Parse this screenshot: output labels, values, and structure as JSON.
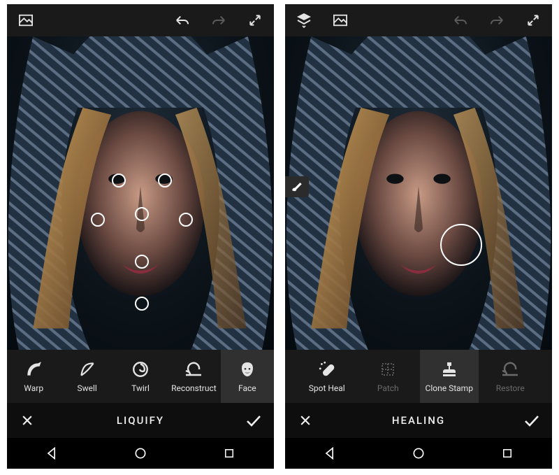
{
  "left": {
    "top": {
      "image_icon": "image-swap-icon",
      "undo": "undo",
      "redo": "redo",
      "fullscreen": "fullscreen"
    },
    "tools": [
      {
        "name": "warp",
        "label": "Warp",
        "selected": false,
        "dim": false
      },
      {
        "name": "swell",
        "label": "Swell",
        "selected": false,
        "dim": false
      },
      {
        "name": "twirl",
        "label": "Twirl",
        "selected": false,
        "dim": false
      },
      {
        "name": "reconstruct",
        "label": "Reconstruct",
        "selected": false,
        "dim": false
      },
      {
        "name": "face",
        "label": "Face",
        "selected": true,
        "dim": false
      }
    ],
    "titlebar": {
      "title": "LIQUIFY"
    }
  },
  "right": {
    "top": {
      "layers_icon": "layers-icon",
      "image_icon": "image-swap-icon",
      "undo": "undo",
      "redo": "redo",
      "fullscreen": "fullscreen"
    },
    "brush_button": "brush-icon",
    "tools": [
      {
        "name": "spot-heal",
        "label": "Spot Heal",
        "selected": false,
        "dim": false
      },
      {
        "name": "patch",
        "label": "Patch",
        "selected": false,
        "dim": true
      },
      {
        "name": "clone-stamp",
        "label": "Clone Stamp",
        "selected": true,
        "dim": false
      },
      {
        "name": "restore",
        "label": "Restore",
        "selected": false,
        "dim": true
      }
    ],
    "titlebar": {
      "title": "HEALING"
    }
  }
}
